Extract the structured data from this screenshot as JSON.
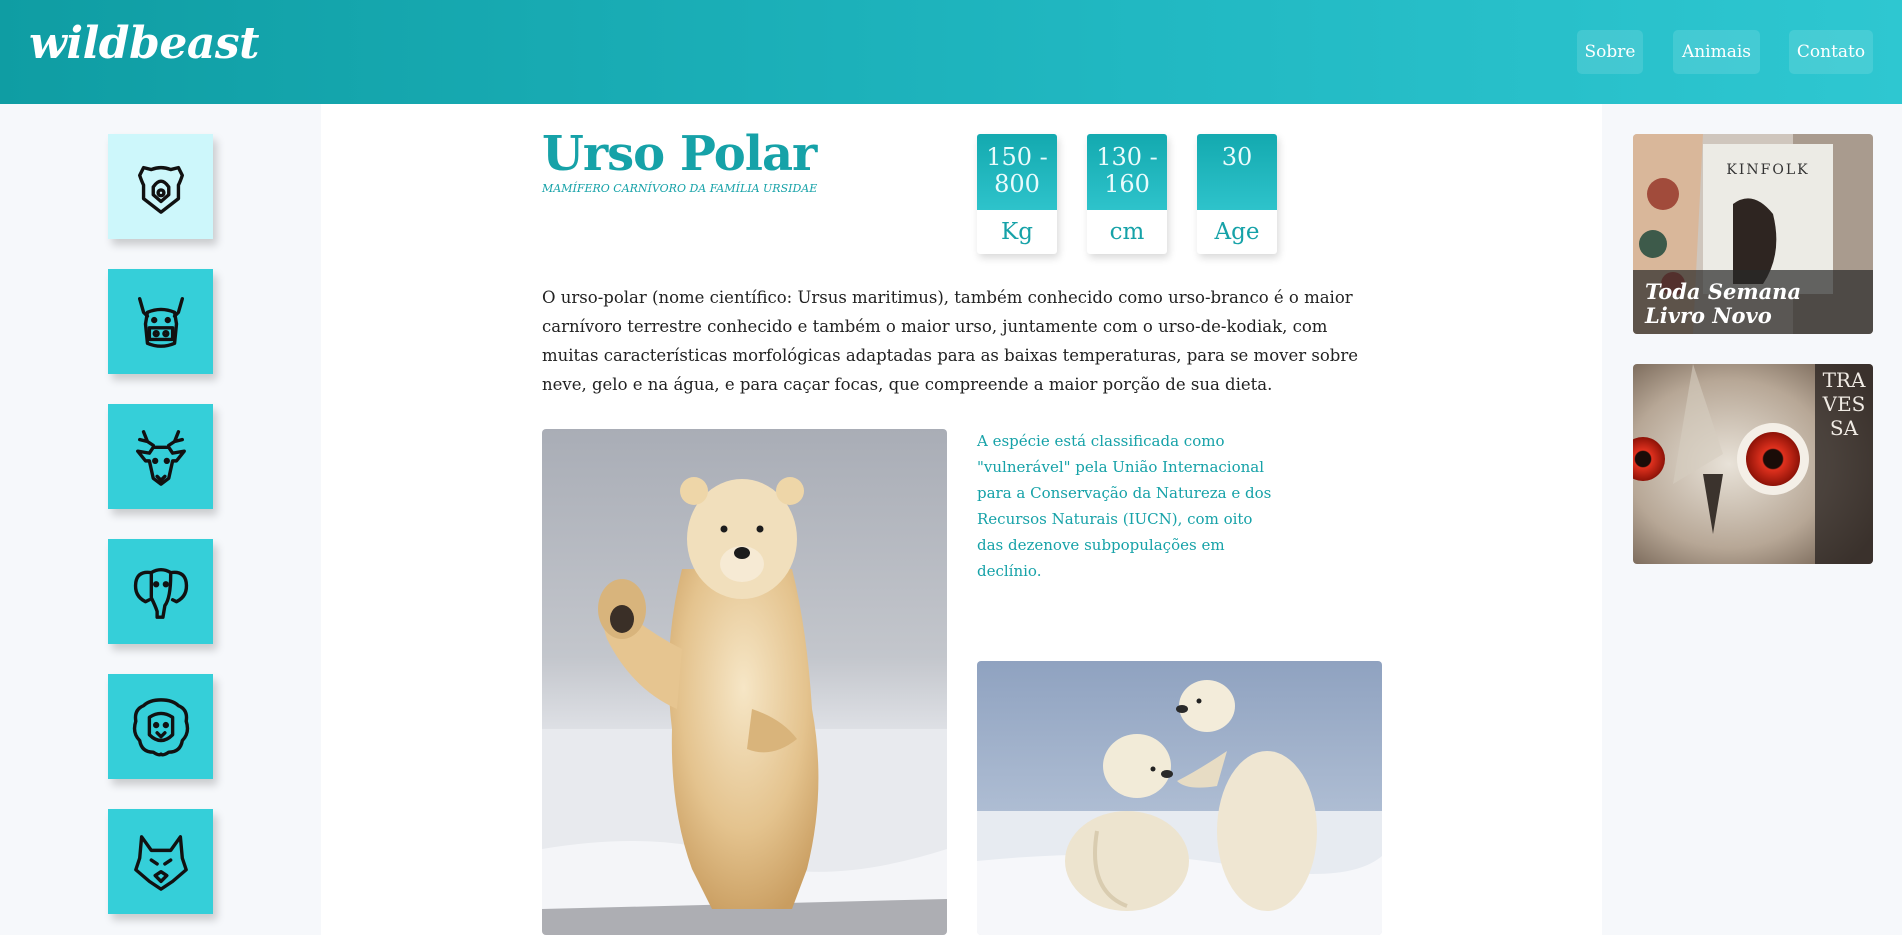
{
  "header": {
    "logo": "wildbeast",
    "nav": [
      {
        "label": "Sobre"
      },
      {
        "label": "Animais"
      },
      {
        "label": "Contato"
      }
    ]
  },
  "sidebar": {
    "animals": [
      {
        "icon": "bear-icon",
        "active": true
      },
      {
        "icon": "hippo-icon",
        "active": false
      },
      {
        "icon": "deer-icon",
        "active": false
      },
      {
        "icon": "elephant-icon",
        "active": false
      },
      {
        "icon": "lion-icon",
        "active": false
      },
      {
        "icon": "wolf-icon",
        "active": false
      }
    ]
  },
  "animal": {
    "name": "Urso Polar",
    "subtitle": "MAMÍFERO CARNÍVORO DA FAMÍLIA URSIDAE",
    "stats": [
      {
        "value": "150 - 800",
        "unit": "Kg"
      },
      {
        "value": "130 - 160",
        "unit": "cm"
      },
      {
        "value": "30",
        "unit": "Age"
      }
    ],
    "description": "O urso-polar (nome científico: Ursus maritimus), também conhecido como urso-branco é o maior carnívoro terrestre conhecido e também o maior urso, juntamente com o urso-de-kodiak, com muitas características morfológicas adaptadas para as baixas temperaturas, para se mover sobre neve, gelo e na água, e para caçar focas, que compreende a maior porção de sua dieta.",
    "conservation": "A espécie está classificada como \"vulnerável\" pela União Internacional para a Conservação da Natureza e dos Recursos Naturais (IUCN), com oito das dezenove subpopulações em declínio."
  },
  "ads": [
    {
      "caption_line1": "Toda Semana",
      "caption_line2": "Livro Novo",
      "book_title": "KINFOLK"
    },
    {
      "vertical_text": "TRAVESSA"
    }
  ],
  "colors": {
    "accent": "#16a2a8",
    "tile": "#35cfd9",
    "tile_active": "#cdf7fb",
    "header_start": "#0f9da3",
    "header_end": "#2ec7d1"
  }
}
